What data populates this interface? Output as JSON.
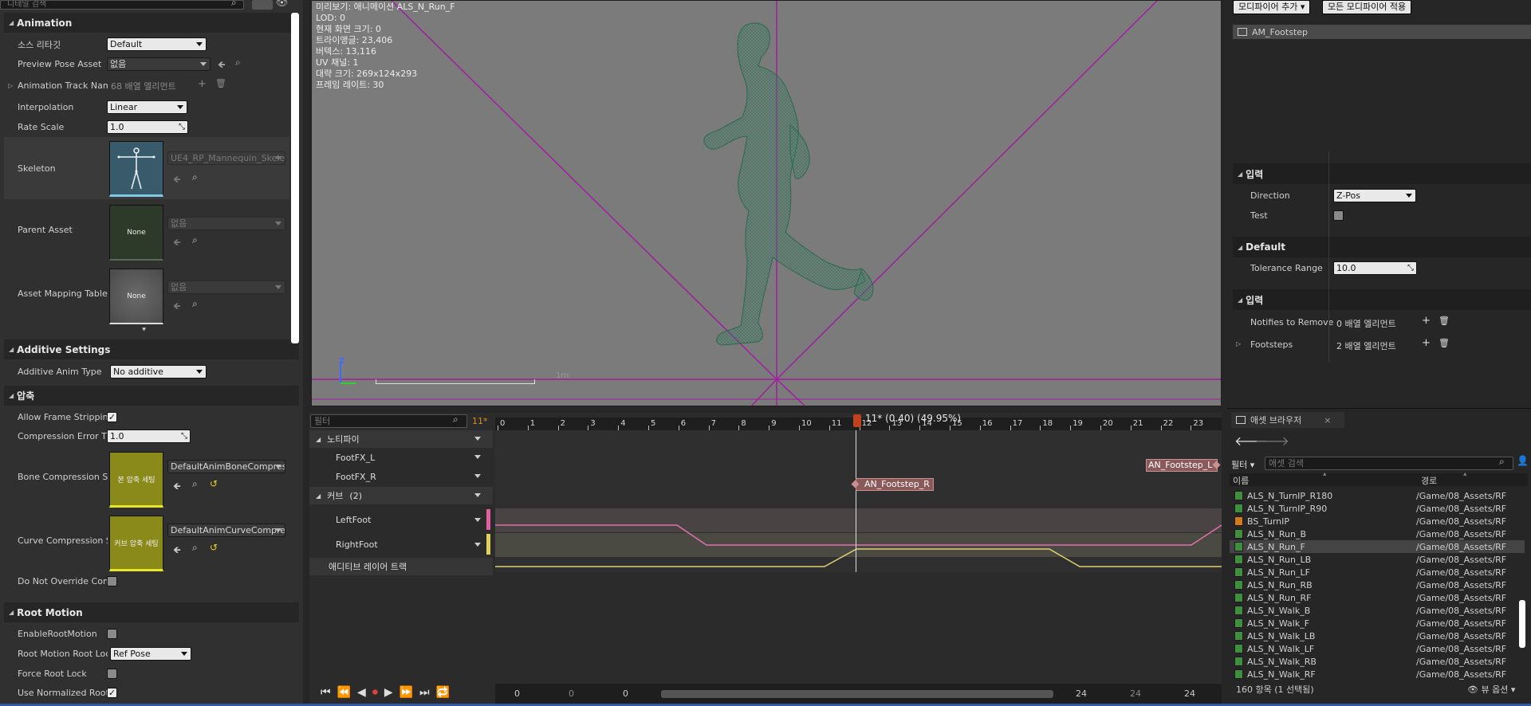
{
  "details": {
    "search_placeholder": "디테일 검색",
    "sections": {
      "animation": "Animation",
      "additive": "Additive Settings",
      "compression": "압축",
      "root_motion": "Root Motion"
    },
    "rows": {
      "source_rate": {
        "label": "소스 리타깃",
        "value": "Default"
      },
      "preview_pose": {
        "label": "Preview Pose Asset",
        "value": "없음"
      },
      "anim_track": {
        "label": "Animation Track Nam",
        "value": "68 배열 엘리먼트"
      },
      "interpolation": {
        "label": "Interpolation",
        "value": "Linear"
      },
      "rate_scale": {
        "label": "Rate Scale",
        "value": "1.0"
      },
      "skeleton": {
        "label": "Skeleton",
        "value": "UE4_RP_Mannequin_Skele"
      },
      "parent_asset": {
        "label": "Parent Asset",
        "value": "없음",
        "thumb": "None"
      },
      "asset_mapping": {
        "label": "Asset Mapping Table",
        "value": "없음",
        "thumb": "None"
      },
      "additive_type": {
        "label": "Additive Anim Type",
        "value": "No additive"
      },
      "allow_strip": {
        "label": "Allow Frame Stripping",
        "checked": true
      },
      "comp_error": {
        "label": "Compression Error Th",
        "value": "1.0"
      },
      "bone_comp": {
        "label": "Bone Compression Se",
        "value": "DefaultAnimBoneCompres",
        "thumb": "본 압축 세팅"
      },
      "curve_comp": {
        "label": "Curve Compression S",
        "value": "DefaultAnimCurveCompre",
        "thumb": "커브 압축 세팅"
      },
      "no_override": {
        "label": "Do Not Override Comp",
        "checked": false
      },
      "enable_root": {
        "label": "EnableRootMotion",
        "checked": false
      },
      "root_lock": {
        "label": "Root Motion Root Loc",
        "value": "Ref Pose"
      },
      "force_lock": {
        "label": "Force Root Lock",
        "checked": false
      },
      "normalized": {
        "label": "Use Normalized Root",
        "checked": true
      }
    }
  },
  "viewport": {
    "info_lines": [
      "미리보기: 애니메이션 ALS_N_Run_F",
      "LOD: 0",
      "현재 화면 크기: 0",
      "트라이앵글: 23,406",
      "버텍스: 13,116",
      "UV 채널: 1",
      "대략 크기: 269x124x293",
      "프레임 레이트: 30"
    ],
    "scale_label": "1m",
    "axis_z": "Z"
  },
  "timeline": {
    "filter_placeholder": "필터",
    "frame_badge": "11*",
    "playhead_label": "11* (0.40) (49.95%)",
    "ticks": [
      "0",
      "1",
      "2",
      "3",
      "4",
      "5",
      "6",
      "7",
      "8",
      "9",
      "10",
      "11",
      "12",
      "13",
      "14",
      "15",
      "16",
      "17",
      "18",
      "19",
      "20",
      "21",
      "22",
      "23"
    ],
    "notify_group": "노티파이",
    "notify_tracks": [
      "FootFX_L",
      "FootFX_R"
    ],
    "curve_group": "커브",
    "curve_count": "(2)",
    "curves": [
      "LeftFoot",
      "RightFoot"
    ],
    "additive_layer": "애디티브 레이어 트랙",
    "notify_l": "AN_Footstep_L",
    "notify_r": "AN_Footstep_R",
    "range": {
      "start1": "0",
      "start2": "0",
      "start3": "0",
      "end1": "24",
      "end2": "24",
      "end3": "24"
    }
  },
  "modifiers": {
    "add_button": "모디파이어 추가",
    "apply_button": "모든 모디파이어 적용",
    "item": "AM_Footstep"
  },
  "props": {
    "input1": "입력",
    "direction_label": "Direction",
    "direction_value": "Z-Pos",
    "test_label": "Test",
    "default_section": "Default",
    "tolerance_label": "Tolerance Range",
    "tolerance_value": "10.0",
    "input2": "입력",
    "notifies_label": "Notifies to Remove",
    "notifies_value": "0 배열 엘리먼트",
    "footsteps_label": "Footsteps",
    "footsteps_value": "2 배열 엘리먼트"
  },
  "assets": {
    "tab_title": "애셋 브라우저",
    "filter_label": "필터",
    "search_placeholder": "애셋 검색",
    "col_name": "이름",
    "col_path": "경로",
    "items": [
      {
        "name": "ALS_N_TurnIP_R180",
        "path": "/Game/08_Assets/RF",
        "type": "anim"
      },
      {
        "name": "ALS_N_TurnIP_R90",
        "path": "/Game/08_Assets/RF",
        "type": "anim"
      },
      {
        "name": "BS_TurnIP",
        "path": "/Game/08_Assets/RF",
        "type": "blendspace"
      },
      {
        "name": "ALS_N_Run_B",
        "path": "/Game/08_Assets/RF",
        "type": "anim"
      },
      {
        "name": "ALS_N_Run_F",
        "path": "/Game/08_Assets/RF",
        "type": "anim",
        "selected": true
      },
      {
        "name": "ALS_N_Run_LB",
        "path": "/Game/08_Assets/RF",
        "type": "anim"
      },
      {
        "name": "ALS_N_Run_LF",
        "path": "/Game/08_Assets/RF",
        "type": "anim"
      },
      {
        "name": "ALS_N_Run_RB",
        "path": "/Game/08_Assets/RF",
        "type": "anim"
      },
      {
        "name": "ALS_N_Run_RF",
        "path": "/Game/08_Assets/RF",
        "type": "anim"
      },
      {
        "name": "ALS_N_Walk_B",
        "path": "/Game/08_Assets/RF",
        "type": "anim"
      },
      {
        "name": "ALS_N_Walk_F",
        "path": "/Game/08_Assets/RF",
        "type": "anim"
      },
      {
        "name": "ALS_N_Walk_LB",
        "path": "/Game/08_Assets/RF",
        "type": "anim"
      },
      {
        "name": "ALS_N_Walk_LF",
        "path": "/Game/08_Assets/RF",
        "type": "anim"
      },
      {
        "name": "ALS_N_Walk_RB",
        "path": "/Game/08_Assets/RF",
        "type": "anim"
      },
      {
        "name": "ALS_N_Walk_RF",
        "path": "/Game/08_Assets/RF",
        "type": "anim"
      }
    ],
    "count_text": "160 항목 (1 선택됨)",
    "view_options": "뷰 옵션"
  }
}
